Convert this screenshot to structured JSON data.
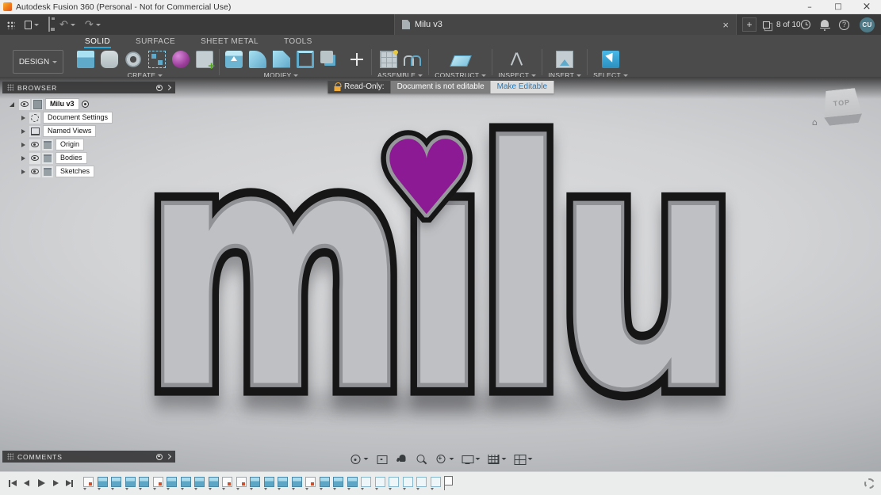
{
  "titlebar": {
    "app_title": "Autodesk Fusion 360 (Personal - Not for Commercial Use)"
  },
  "appbar": {
    "document_tab": "Milu v3",
    "doc_counter": "8 of 10",
    "avatar_initials": "CU"
  },
  "ribbon": {
    "design_menu": "DESIGN",
    "tabs": [
      {
        "label": "SOLID",
        "active": true
      },
      {
        "label": "SURFACE",
        "active": false
      },
      {
        "label": "SHEET METAL",
        "active": false
      },
      {
        "label": "TOOLS",
        "active": false
      }
    ],
    "toolbar_groups": [
      {
        "label": "CREATE",
        "sep_before": false,
        "icons": [
          "extrude-icon",
          "form-icon",
          "coil-icon",
          "pattern-icon",
          "create-form-icon",
          "insert-mesh-icon"
        ]
      },
      {
        "label": "MODIFY",
        "sep_before": true,
        "icons": [
          "press-pull-icon",
          "fillet-icon",
          "chamfer-icon",
          "shell-icon",
          "combine-icon"
        ]
      },
      {
        "label": "",
        "sep_before": false,
        "icons": [
          "move-icon"
        ]
      },
      {
        "label": "ASSEMBLE",
        "sep_before": true,
        "icons": [
          "new-component-icon",
          "joint-icon"
        ]
      },
      {
        "label": "CONSTRUCT",
        "sep_before": true,
        "icons": [
          "construction-plane-icon"
        ]
      },
      {
        "label": "INSPECT",
        "sep_before": true,
        "icons": [
          "measure-icon"
        ]
      },
      {
        "label": "INSERT",
        "sep_before": true,
        "icons": [
          "insert-icon"
        ]
      },
      {
        "label": "SELECT",
        "sep_before": true,
        "icons": [
          "select-icon"
        ]
      }
    ]
  },
  "readonly_banner": {
    "label": "Read-Only:",
    "message": "Document is not editable",
    "action": "Make Editable"
  },
  "browser": {
    "header": "BROWSER",
    "root_label": "Milu v3",
    "items": [
      {
        "label": "Document Settings",
        "icon": "gear-icon"
      },
      {
        "label": "Named Views",
        "icon": "named-views-icon"
      },
      {
        "label": "Origin",
        "icon": "origin-folder-icon"
      },
      {
        "label": "Bodies",
        "icon": "bodies-folder-icon"
      },
      {
        "label": "Sketches",
        "icon": "sketches-folder-icon"
      }
    ]
  },
  "viewcube": {
    "top_face": "TOP"
  },
  "model": {
    "word": "milu",
    "word_display": "mılu",
    "heart_glyph": "♥",
    "body_color": "#bfc0c3",
    "outline_color": "#161616",
    "heart_color": "#8d1a95"
  },
  "comments": {
    "header": "COMMENTS"
  },
  "nav_toolbar": [
    {
      "name": "orbit-icon",
      "caret": true
    },
    {
      "name": "look-at-icon",
      "caret": false
    },
    {
      "name": "pan-icon",
      "caret": false
    },
    {
      "name": "zoom-icon",
      "caret": false
    },
    {
      "name": "fit-icon",
      "caret": true
    },
    {
      "name": "display-settings-icon",
      "caret": true
    },
    {
      "name": "grid-layout-icon",
      "caret": true
    },
    {
      "name": "viewports-icon",
      "caret": true
    }
  ],
  "timeline": {
    "playback": [
      "skip-start-icon",
      "step-back-icon",
      "play-icon",
      "step-forward-icon",
      "skip-end-icon"
    ],
    "features": [
      "sketch",
      "extrude",
      "extrude",
      "extrude",
      "extrude",
      "sketch",
      "extrude",
      "extrude",
      "extrude",
      "extrude",
      "sketch",
      "sketch",
      "extrude",
      "extrude",
      "extrude",
      "extrude",
      "sketch",
      "extrude",
      "extrude",
      "extrude",
      "hollow",
      "hollow",
      "hollow",
      "hollow",
      "hollow",
      "hollow"
    ]
  },
  "colors": {
    "accent_blue": "#28a7dd",
    "icon_blue": "#5fa9ca",
    "appbar_bg": "#3a3a3a",
    "ribbon_bg": "#4b4b4b",
    "canvas_light": "#dcdddf",
    "canvas_dark": "#8b8e92"
  }
}
